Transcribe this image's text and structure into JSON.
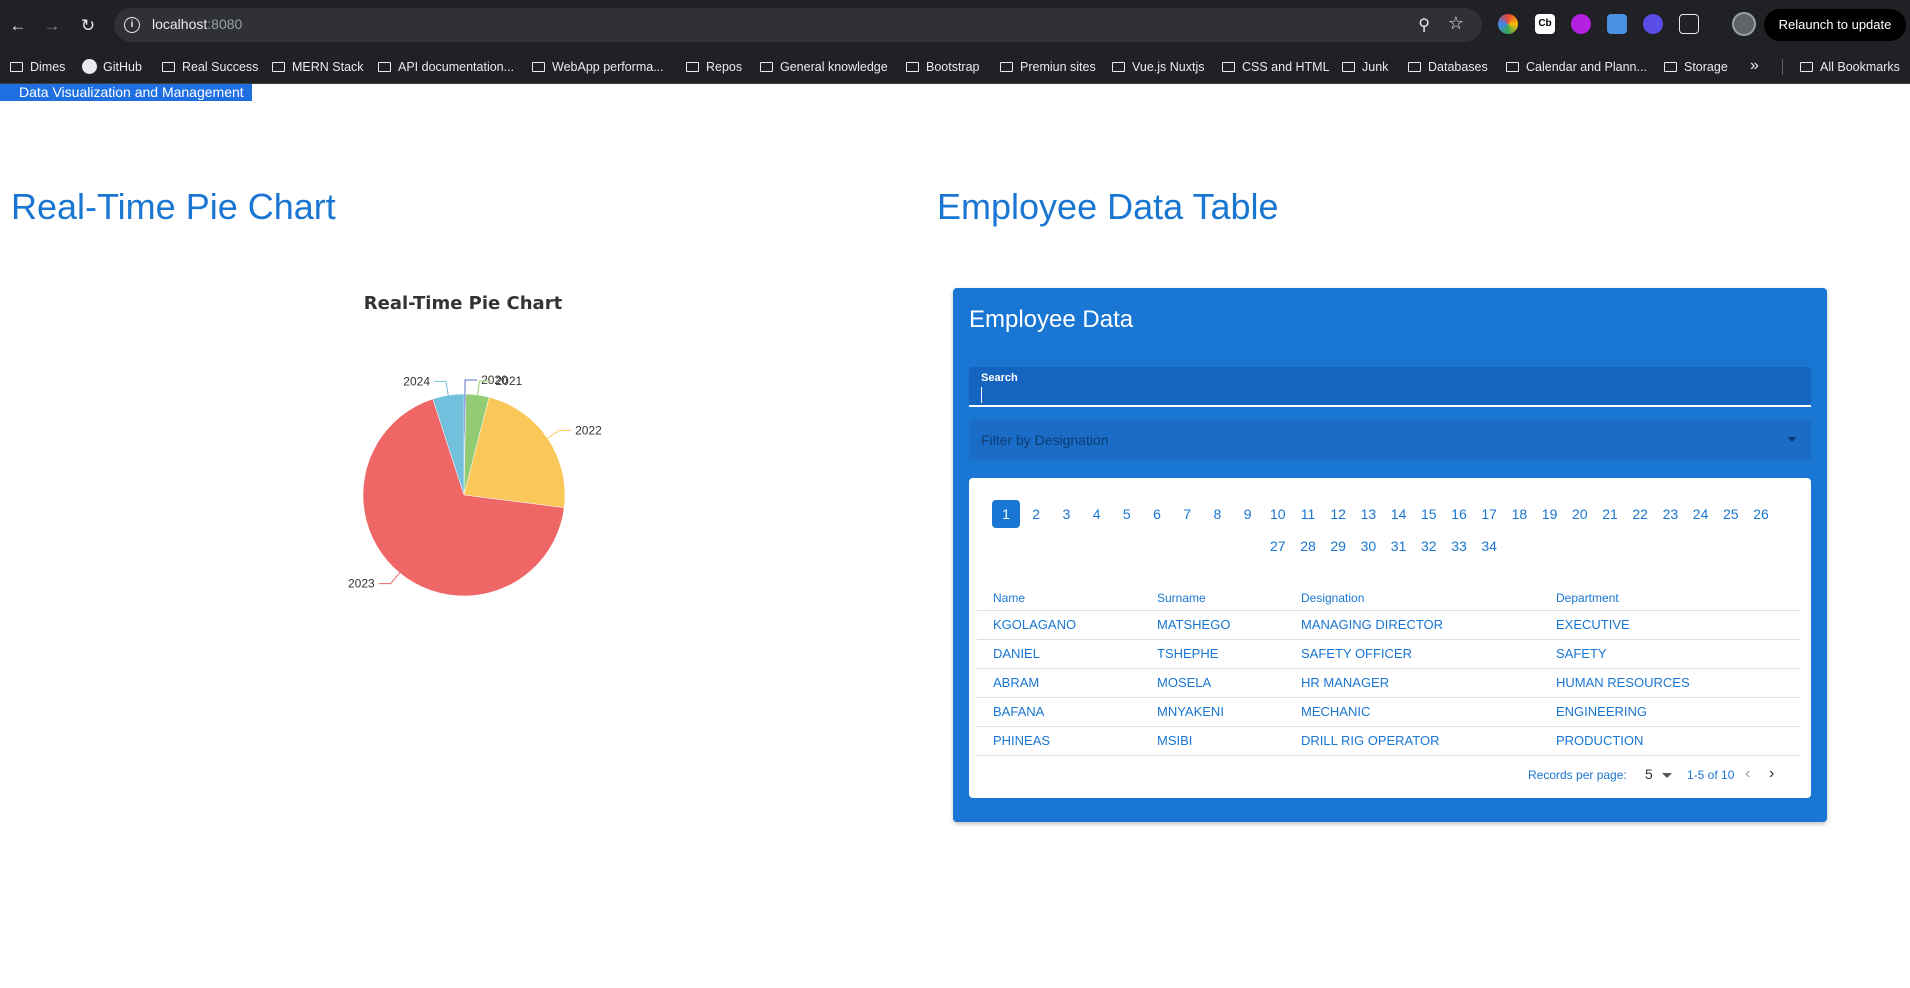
{
  "browser": {
    "url_host": "localhost",
    "url_port": ":8080",
    "relaunch_label": "Relaunch to update",
    "extensions": [
      "Cb"
    ],
    "bookmarks": [
      "Dimes",
      "GitHub",
      "Real Success",
      "MERN Stack",
      "API documentation...",
      "WebApp performa...",
      "Repos",
      "General knowledge",
      "Bootstrap",
      "Premiun sites",
      "Vue.js Nuxtjs",
      "CSS and HTML",
      "Junk",
      "Databases",
      "Calendar and Plann...",
      "Storage"
    ],
    "all_bookmarks": "All Bookmarks"
  },
  "app": {
    "bar_title": "Data Visualization and Management",
    "left_title": "Real-Time Pie Chart",
    "right_title": "Employee Data Table"
  },
  "chart_data": {
    "type": "pie",
    "title": "Real-Time Pie Chart",
    "categories": [
      "2020",
      "2021",
      "2022",
      "2023",
      "2024"
    ],
    "values": [
      0.3,
      3.7,
      23,
      68,
      5
    ],
    "colors": [
      "#5470c6",
      "#91cc75",
      "#fac858",
      "#ee6666",
      "#73c0de"
    ]
  },
  "card": {
    "title": "Employee Data",
    "search_label": "Search",
    "search_value": "",
    "filter_placeholder": "Filter by Designation",
    "pages": [
      "1",
      "2",
      "3",
      "4",
      "5",
      "6",
      "7",
      "8",
      "9",
      "10",
      "11",
      "12",
      "13",
      "14",
      "15",
      "16",
      "17",
      "18",
      "19",
      "20",
      "21",
      "22",
      "23",
      "24",
      "25",
      "26",
      "27",
      "28",
      "29",
      "30",
      "31",
      "32",
      "33",
      "34"
    ],
    "active_page": "1",
    "headers": [
      "Name",
      "Surname",
      "Designation",
      "Department"
    ],
    "rows": [
      [
        "KGOLAGANO",
        "MATSHEGO",
        "MANAGING DIRECTOR",
        "EXECUTIVE"
      ],
      [
        "DANIEL",
        "TSHEPHE",
        "SAFETY OFFICER",
        "SAFETY"
      ],
      [
        "ABRAM",
        "MOSELA",
        "HR MANAGER",
        "HUMAN RESOURCES"
      ],
      [
        "BAFANA",
        "MNYAKENI",
        "MECHANIC",
        "ENGINEERING"
      ],
      [
        "PHINEAS",
        "MSIBI",
        "DRILL RIG OPERATOR",
        "PRODUCTION"
      ]
    ],
    "records_per_page_label": "Records per page:",
    "records_per_page": "5",
    "range": "1-5 of 10"
  }
}
